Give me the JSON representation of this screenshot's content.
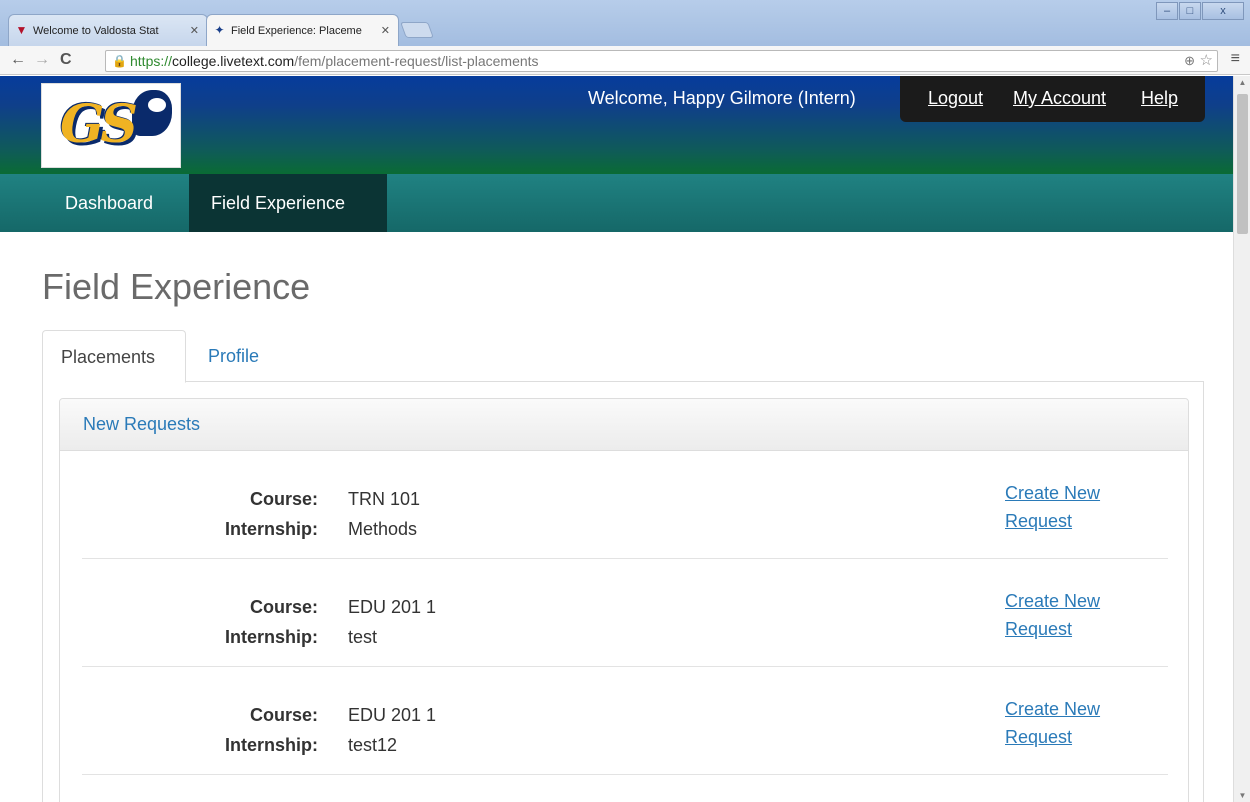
{
  "browser": {
    "tabs": [
      {
        "title": "Welcome to Valdosta Stat",
        "active": false
      },
      {
        "title": "Field Experience: Placeme",
        "active": true
      }
    ],
    "url": {
      "scheme": "https://",
      "host": "college.livetext.com",
      "path": "/fem/placement-request/list-placements"
    },
    "window_controls": {
      "minimize": "–",
      "maximize": "□",
      "close": "x"
    }
  },
  "header": {
    "logo_text": "GS",
    "welcome": "Welcome, Happy Gilmore (Intern)",
    "links": {
      "logout": "Logout",
      "account": "My Account",
      "help": "Help"
    }
  },
  "nav": {
    "dashboard": "Dashboard",
    "field_experience": "Field Experience"
  },
  "page": {
    "title": "Field Experience",
    "tabs": {
      "placements": "Placements",
      "profile": "Profile"
    },
    "panel_heading": "New Requests",
    "labels": {
      "course": "Course:",
      "internship": "Internship:"
    },
    "cta_line1": "Create New",
    "cta_line2": "Request",
    "requests": [
      {
        "course": "TRN 101",
        "internship": "Methods"
      },
      {
        "course": "EDU 201 1",
        "internship": "test"
      },
      {
        "course": "EDU 201 1",
        "internship": "test12"
      }
    ]
  },
  "colors": {
    "header_top": "#063c9c",
    "header_bottom": "#0a6b34",
    "nav_bg": "#208282",
    "nav_active": "#0b3434",
    "link": "#2a7ab8",
    "logo_gold": "#f0b323"
  }
}
